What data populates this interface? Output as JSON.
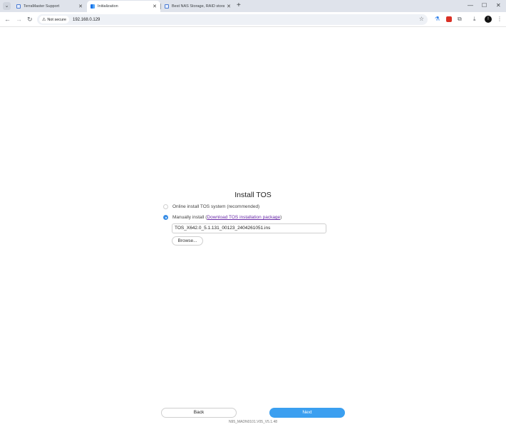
{
  "browser": {
    "tabs": [
      {
        "title": "TerraMaster Support",
        "active": false
      },
      {
        "title": "Initialization",
        "active": true
      },
      {
        "title": "Best NAS Storage, RAID storage",
        "active": false
      }
    ],
    "address": {
      "security_label": "Not secure",
      "url": "192.168.0.129"
    }
  },
  "page": {
    "title": "Install TOS",
    "online_option": "Online install TOS system (recommended)",
    "manual_option_prefix": "Manually install (",
    "download_link": "Download TOS installation package",
    "manual_option_suffix": ")",
    "file_value": "TOS_X642.0_5.1.131_00123_2404261051.ins",
    "browse_label": "Browse...",
    "back_label": "Back",
    "next_label": "Next",
    "version": "N95_MADN0101.V05_V5.1.48"
  },
  "colors": {
    "accent": "#3b9ff0",
    "link": "#6a2ba8"
  }
}
